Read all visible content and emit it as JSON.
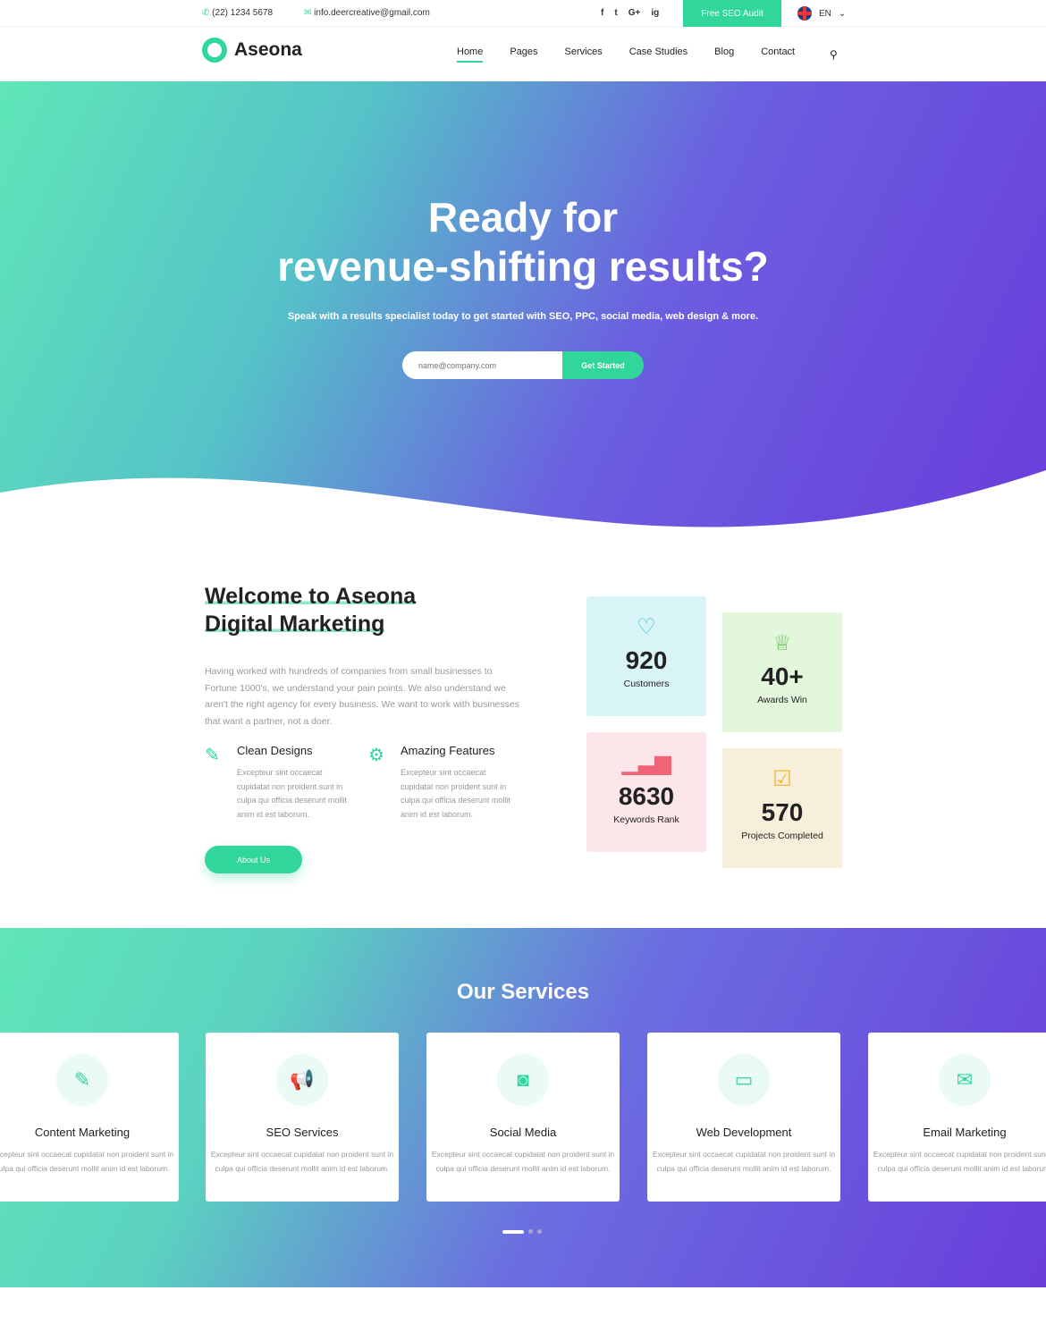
{
  "topbar": {
    "phone": "(22) 1234 5678",
    "email": "info.deercreative@gmail.com",
    "social": [
      "f",
      "t",
      "G+",
      "ig"
    ],
    "audit": "Free SEO Audit",
    "lang": "EN"
  },
  "nav": {
    "brand": "Aseona",
    "items": [
      "Home",
      "Pages",
      "Services",
      "Case Studies",
      "Blog",
      "Contact"
    ]
  },
  "hero": {
    "title1": "Ready for",
    "title2": "revenue-shifting results?",
    "subtitle": "Speak with a results specialist today to get started with SEO, PPC, social media, web design & more.",
    "placeholder": "name@company.com",
    "cta": "Get Started"
  },
  "welcome": {
    "title1": "Welcome to Aseona",
    "title2": "Digital Marketing",
    "desc": "Having worked with hundreds of companies from small businesses to Fortune 1000's, we understand your pain points. We also understand we aren't the right agency for every business. We want to work with businesses that want a partner, not a doer.",
    "features": [
      {
        "title": "Clean Designs",
        "text": "Excepteur sint occaecat cupidatat non proident sunt in culpa qui officia deserunt mollit anim id est laborum."
      },
      {
        "title": "Amazing Features",
        "text": "Excepteur sint occaecat cupidatat non proident sunt in culpa qui officia deserunt mollit anim id est laborum."
      }
    ],
    "button": "About Us"
  },
  "stats": [
    {
      "num": "920",
      "label": "Customers",
      "icon": "heart-icon",
      "bg": "#d9f4f6",
      "color": "#3cc3d3"
    },
    {
      "num": "40+",
      "label": "Awards Win",
      "icon": "crown-icon",
      "bg": "#e3f7dc",
      "color": "#6cc25a"
    },
    {
      "num": "8630",
      "label": "Keywords Rank",
      "icon": "bar-chart-icon",
      "bg": "#fde6e9",
      "color": "#f06478"
    },
    {
      "num": "570",
      "label": "Projects Completed",
      "icon": "checkbox-icon",
      "bg": "#f7efda",
      "color": "#f3b632"
    }
  ],
  "services": {
    "title": "Our Services",
    "items": [
      {
        "title": "Content Marketing",
        "icon": "edit-icon",
        "text": "Excepteur sint occaecat cupidatat non proident sunt in culpa qui officia deserunt mollit anim id est laborum."
      },
      {
        "title": "SEO Services",
        "icon": "megaphone-icon",
        "text": "Excepteur sint occaecat cupidatat non proident sunt in culpa qui officia deserunt mollit anim id est laborum."
      },
      {
        "title": "Social Media",
        "icon": "camera-icon",
        "text": "Excepteur sint occaecat cupidatat non proident sunt in culpa qui officia deserunt mollit anim id est laborum."
      },
      {
        "title": "Web Development",
        "icon": "monitor-icon",
        "text": "Excepteur sint occaecat cupidatat non proident sunt in culpa qui officia deserunt mollit anim id est laborum."
      },
      {
        "title": "Email Marketing",
        "icon": "mail-icon",
        "text": "Excepteur sint occaecat cupidatat non proident sunt in culpa qui officia deserunt mollit anim id est laborum."
      }
    ]
  },
  "accent": "#30d69a"
}
